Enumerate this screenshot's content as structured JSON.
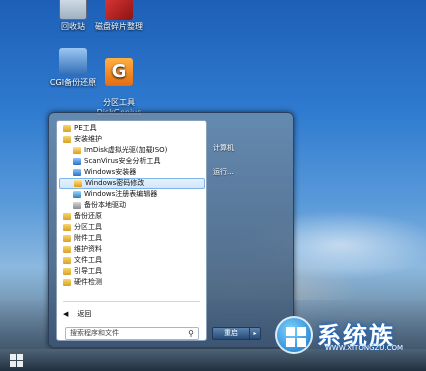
{
  "desktop": {
    "icons": [
      {
        "label": "回收站",
        "icon": "recycle-bin-icon"
      },
      {
        "label": "磁盘碎片整理",
        "icon": "defrag-icon"
      },
      {
        "label": "CGI备份还原",
        "icon": "cgi-backup-icon"
      },
      {
        "label": "分区工具\nDiskGenius",
        "icon": "diskgenius-icon"
      }
    ]
  },
  "start_menu": {
    "tree": [
      {
        "label": "PE工具",
        "type": "folder",
        "level": 0
      },
      {
        "label": "安装维护",
        "type": "folder",
        "level": 0
      },
      {
        "label": "ImDisk虚拟光驱(加载ISO)",
        "type": "app",
        "level": 1
      },
      {
        "label": "ScanVirus安全分析工具",
        "type": "app",
        "level": 1
      },
      {
        "label": "Windows安装器",
        "type": "app",
        "level": 1
      },
      {
        "label": "Windows密码修改",
        "type": "app",
        "level": 1,
        "selected": true
      },
      {
        "label": "Windows注册表编辑器",
        "type": "app",
        "level": 1
      },
      {
        "label": "备份本地驱动",
        "type": "app",
        "level": 1
      },
      {
        "label": "备份还原",
        "type": "folder",
        "level": 0
      },
      {
        "label": "分区工具",
        "type": "folder",
        "level": 0
      },
      {
        "label": "附件工具",
        "type": "folder",
        "level": 0
      },
      {
        "label": "维护资料",
        "type": "folder",
        "level": 0
      },
      {
        "label": "文件工具",
        "type": "folder",
        "level": 0
      },
      {
        "label": "引导工具",
        "type": "folder",
        "level": 0
      },
      {
        "label": "硬件检测",
        "type": "folder",
        "level": 0
      }
    ],
    "back_label": "返回",
    "search_placeholder": "搜索程序和文件",
    "right_items": [
      "计算机",
      "运行..."
    ],
    "shutdown_label": "重启"
  },
  "watermark": {
    "title": "系统族",
    "url": "WWW.XITONGZU.COM"
  }
}
